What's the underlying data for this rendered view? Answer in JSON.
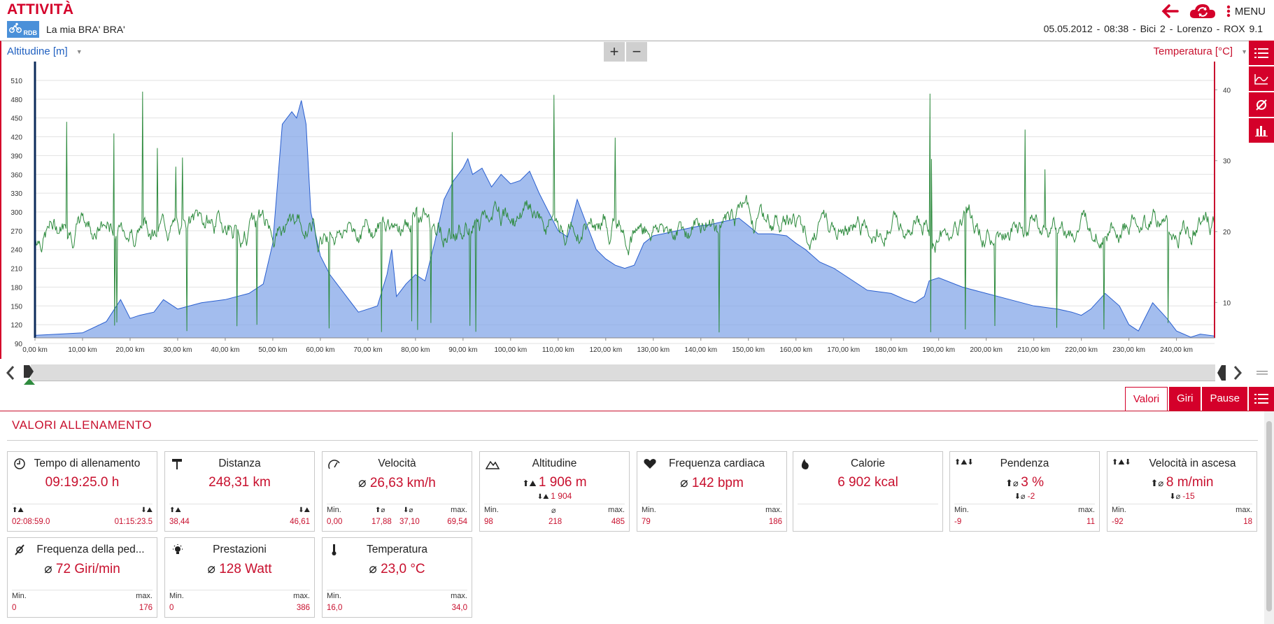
{
  "header": {
    "title": "ATTIVITÀ",
    "logo_text": "RDB",
    "activity_name": "La mia BRA' BRA'",
    "menu_label": "MENU",
    "info": "05.05.2012  -  08:38  -  Bici 2  -  Lorenzo  -  ROX 9.1"
  },
  "chart_controls": {
    "left_axis_label": "Altitudine [m]",
    "right_axis_label": "Temperatura [°C]",
    "zoom_in": "+",
    "zoom_out": "−"
  },
  "chart_data": {
    "type": "area",
    "series": [
      {
        "name": "Altitudine [m]",
        "type": "area",
        "color": "#7fa3e8",
        "x": [
          0,
          5,
          10,
          15,
          18,
          20,
          22,
          25,
          27,
          30,
          35,
          40,
          45,
          48,
          50,
          52,
          54,
          55,
          56,
          57,
          58,
          60,
          62,
          65,
          68,
          70,
          72,
          74,
          75,
          76,
          78,
          80,
          82,
          84,
          86,
          88,
          90,
          91,
          92,
          94,
          96,
          98,
          100,
          102,
          104,
          106,
          108,
          110,
          112,
          114,
          116,
          118,
          120,
          122,
          124,
          126,
          128,
          130,
          132,
          135,
          138,
          140,
          142,
          145,
          148,
          150,
          152,
          155,
          158,
          160,
          162,
          165,
          168,
          170,
          175,
          180,
          183,
          185,
          187,
          188,
          190,
          195,
          200,
          205,
          210,
          215,
          218,
          220,
          222,
          225,
          228,
          230,
          232,
          235,
          238,
          240,
          243,
          245,
          248
        ],
        "y": [
          103,
          105,
          107,
          125,
          160,
          130,
          135,
          140,
          160,
          145,
          155,
          160,
          170,
          185,
          250,
          440,
          460,
          450,
          478,
          440,
          300,
          230,
          200,
          170,
          140,
          145,
          150,
          200,
          240,
          165,
          185,
          200,
          190,
          250,
          320,
          350,
          370,
          385,
          360,
          370,
          340,
          360,
          345,
          350,
          365,
          330,
          300,
          270,
          260,
          320,
          280,
          240,
          225,
          215,
          210,
          215,
          250,
          262,
          265,
          270,
          275,
          278,
          280,
          285,
          290,
          278,
          265,
          265,
          262,
          250,
          240,
          220,
          210,
          200,
          175,
          170,
          160,
          155,
          165,
          190,
          195,
          180,
          170,
          160,
          150,
          145,
          140,
          135,
          145,
          170,
          150,
          120,
          110,
          155,
          130,
          110,
          100,
          105,
          102
        ]
      },
      {
        "name": "Temperatura [°C]",
        "type": "line",
        "color": "#2e8b3e"
      }
    ],
    "xlim": [
      0,
      248
    ],
    "ylim_left": [
      90,
      520
    ],
    "ylim_right": [
      5,
      43
    ],
    "x_ticks": [
      "0,00 km",
      "10,00 km",
      "20,00 km",
      "30,00 km",
      "40,00 km",
      "50,00 km",
      "60,00 km",
      "70,00 km",
      "80,00 km",
      "90,00 km",
      "100,00 km",
      "110,00 km",
      "120,00 km",
      "130,00 km",
      "140,00 km",
      "150,00 km",
      "160,00 km",
      "170,00 km",
      "180,00 km",
      "190,00 km",
      "200,00 km",
      "210,00 km",
      "220,00 km",
      "230,00 km",
      "240,00 km"
    ],
    "y_left_ticks": [
      90,
      120,
      150,
      180,
      210,
      240,
      270,
      300,
      330,
      360,
      390,
      420,
      450,
      480,
      510
    ],
    "y_right_ticks": [
      10,
      20,
      30,
      40
    ],
    "grid": true
  },
  "tabs": [
    "Valori",
    "Giri",
    "Pause"
  ],
  "section_title": "VALORI ALLENAMENTO",
  "cards": [
    {
      "title": "Tempo di allenamento",
      "main": "09:19:25.0 h",
      "sub": "",
      "left_val": "02:08:59.0",
      "right_val": "01:15:23.5",
      "mid_val": "",
      "left_lbl": "",
      "right_lbl": "",
      "mid_lbl": ""
    },
    {
      "title": "Distanza",
      "main": "248,31 km",
      "sub": "",
      "left_val": "38,44",
      "right_val": "46,61",
      "mid_val": "",
      "left_lbl": "",
      "right_lbl": "",
      "mid_lbl": ""
    },
    {
      "title": "Velocità",
      "main": "26,63 km/h",
      "sub": "",
      "left_lbl": "Min.",
      "right_lbl": "max.",
      "left_val": "0,00",
      "mid_val": "17,88",
      "mid2_val": "37,10",
      "right_val": "69,54",
      "mid_lbl": ""
    },
    {
      "title": "Altitudine",
      "main": "1 906 m",
      "sub": "1 904",
      "left_lbl": "Min.",
      "right_lbl": "max.",
      "left_val": "98",
      "mid_val": "218",
      "right_val": "485",
      "mid_lbl": "⌀"
    },
    {
      "title": "Frequenza cardiaca",
      "main": "142 bpm",
      "sub": "",
      "left_lbl": "Min.",
      "right_lbl": "max.",
      "left_val": "79",
      "right_val": "186",
      "mid_val": "",
      "mid_lbl": ""
    },
    {
      "title": "Calorie",
      "main": "6 902 kcal",
      "sub": "",
      "left_lbl": "",
      "right_lbl": "",
      "left_val": "",
      "right_val": "",
      "mid_val": "",
      "mid_lbl": ""
    },
    {
      "title": "Pendenza",
      "main": "3 %",
      "sub": "-2",
      "left_lbl": "Min.",
      "right_lbl": "max.",
      "left_val": "-9",
      "right_val": "11",
      "mid_val": "",
      "mid_lbl": ""
    },
    {
      "title": "Velocità in ascesa",
      "main": "8 m/min",
      "sub": "-15",
      "left_lbl": "Min.",
      "right_lbl": "max.",
      "left_val": "-92",
      "right_val": "18",
      "mid_val": "",
      "mid_lbl": ""
    },
    {
      "title": "Frequenza della ped...",
      "main": "72 Giri/min",
      "sub": "",
      "left_lbl": "Min.",
      "right_lbl": "max.",
      "left_val": "0",
      "right_val": "176",
      "mid_val": "",
      "mid_lbl": ""
    },
    {
      "title": "Prestazioni",
      "main": "128 Watt",
      "sub": "",
      "left_lbl": "Min.",
      "right_lbl": "max.",
      "left_val": "0",
      "right_val": "386",
      "mid_val": "",
      "mid_lbl": ""
    },
    {
      "title": "Temperatura",
      "main": "23,0 °C",
      "sub": "",
      "left_lbl": "Min.",
      "right_lbl": "max.",
      "left_val": "16,0",
      "right_val": "34,0",
      "mid_val": "",
      "mid_lbl": ""
    }
  ],
  "colors": {
    "accent": "#d4002a",
    "altitude": "#7fa3e8",
    "altitude_line": "#2a5fcf",
    "temperature": "#2e8b3e"
  }
}
